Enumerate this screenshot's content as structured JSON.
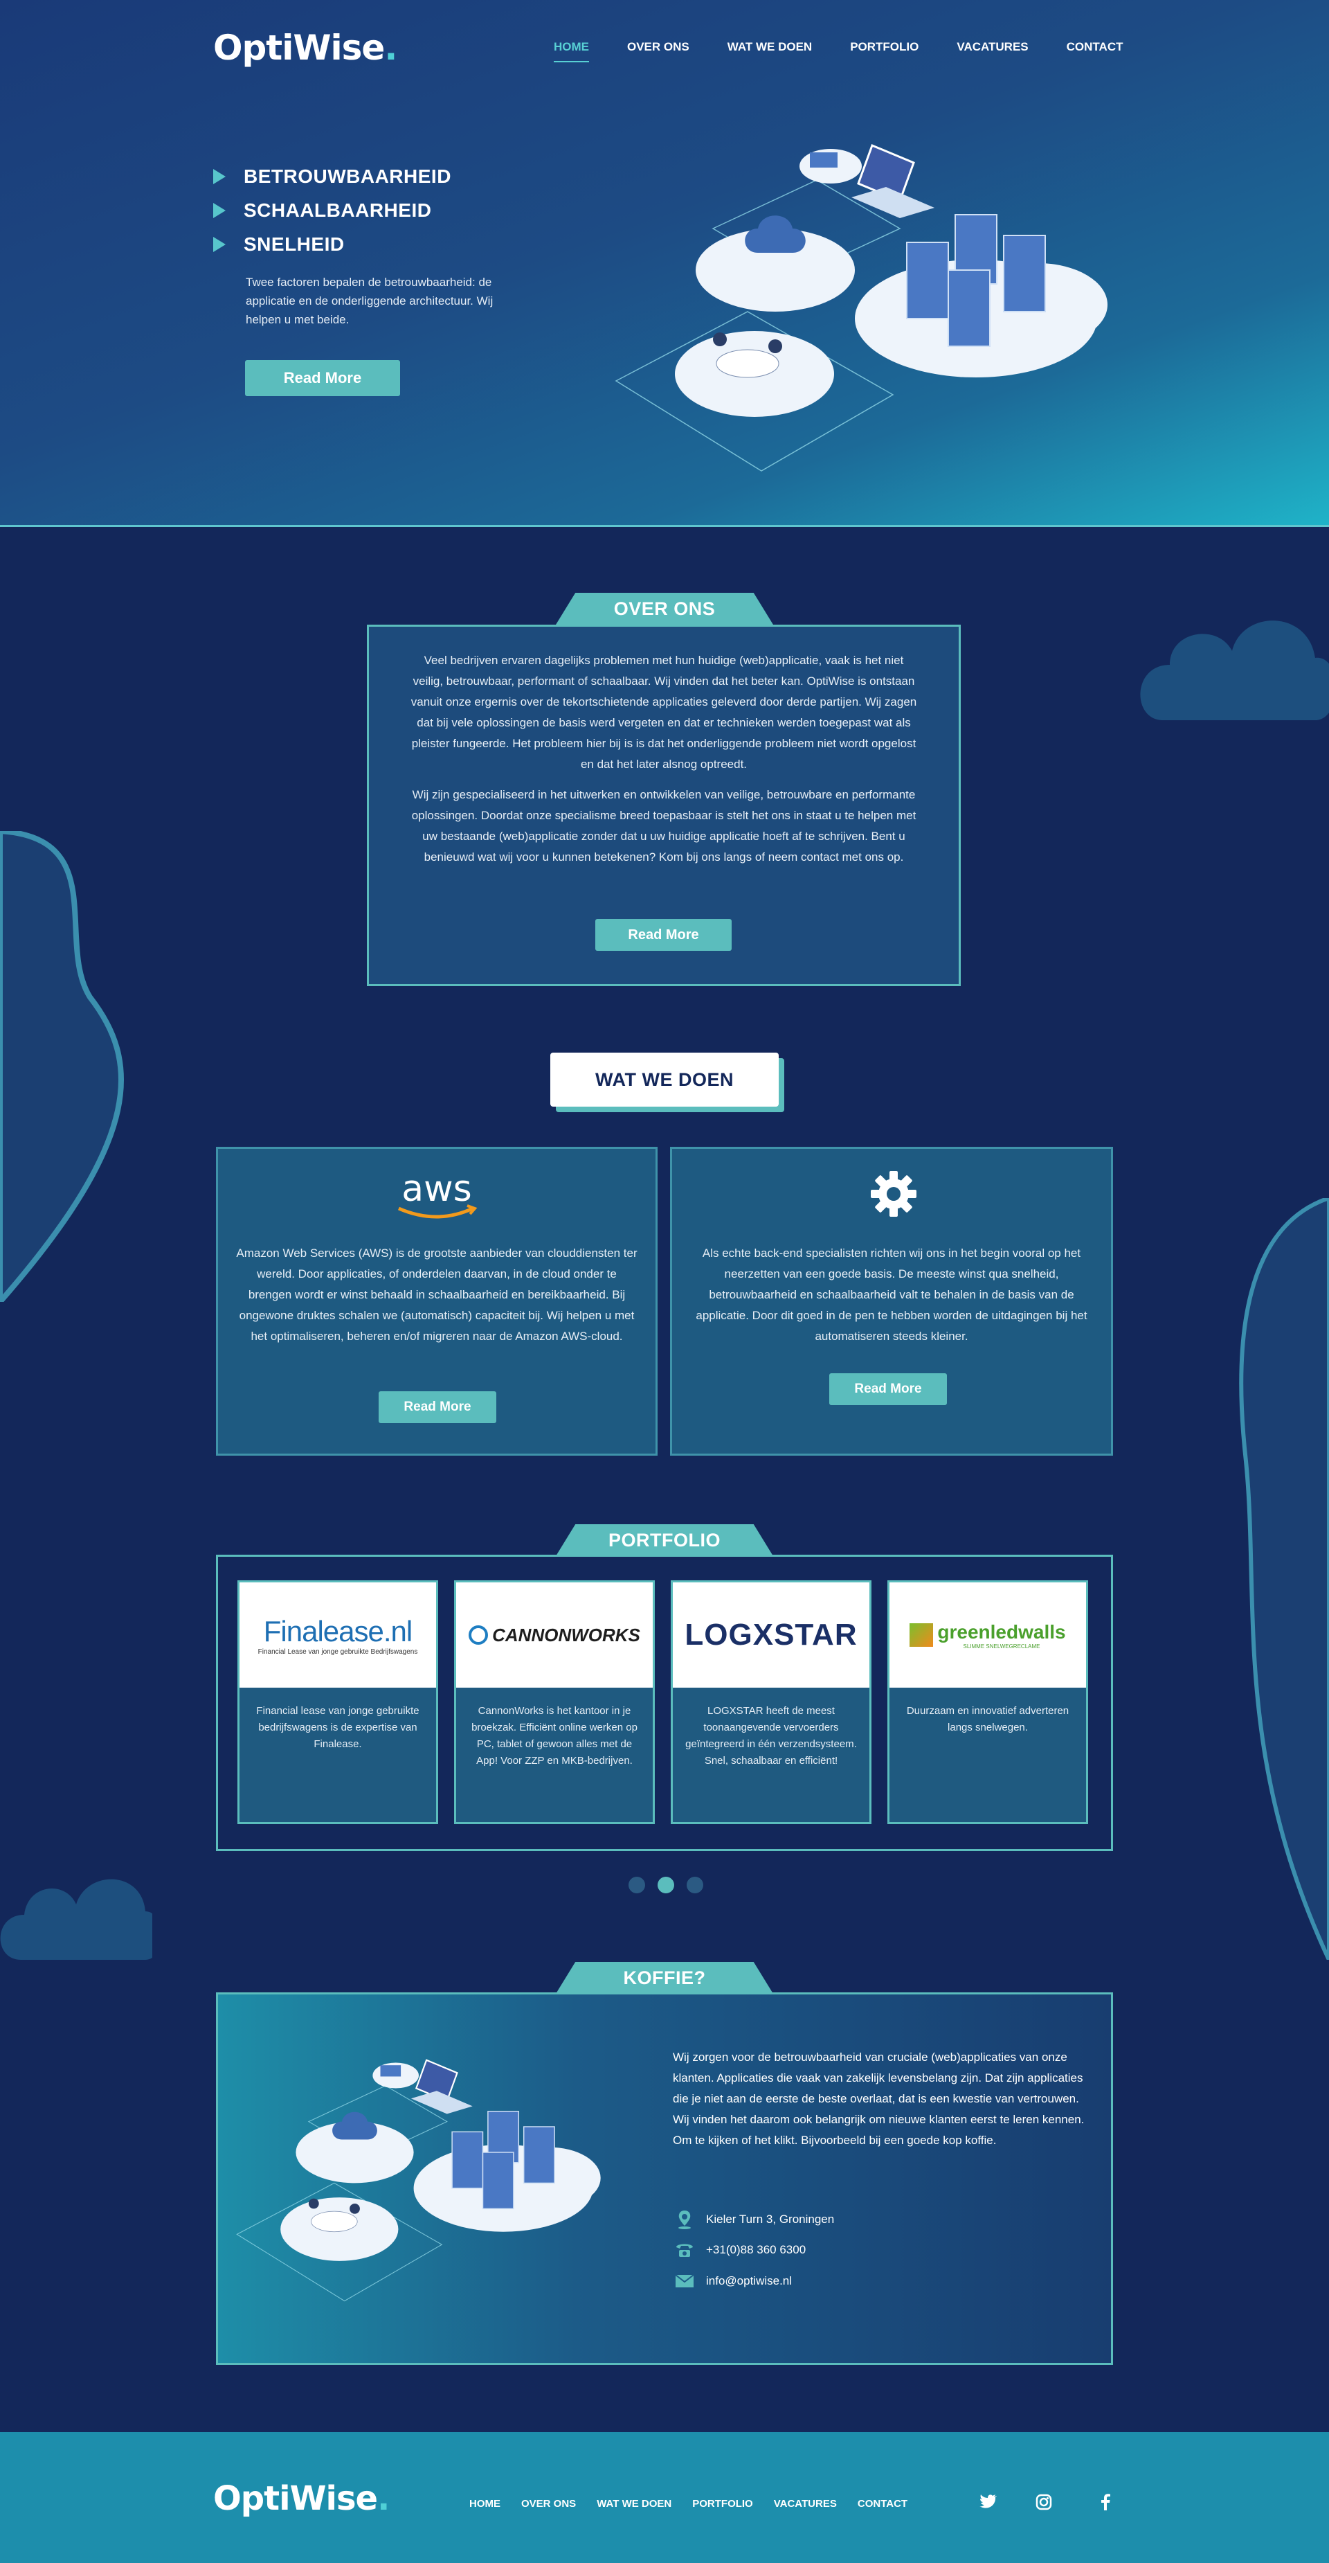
{
  "brand": {
    "name": "OptiWise",
    "dot": "."
  },
  "nav": {
    "items": [
      "HOME",
      "OVER ONS",
      "WAT WE DOEN",
      "PORTFOLIO",
      "VACATURES",
      "CONTACT"
    ],
    "active": "HOME"
  },
  "hero": {
    "bullets": [
      "BETROUWBAARHEID",
      "SCHAALBAARHEID",
      "SNELHEID"
    ],
    "text": "Twee factoren bepalen de betrouwbaarheid: de applicatie en de onderliggende architectuur. Wij helpen u met beide.",
    "button": "Read More"
  },
  "over_ons": {
    "title": "OVER ONS",
    "paragraph1": "Veel bedrijven ervaren dagelijks problemen met hun huidige (web)applicatie, vaak is het niet veilig, betrouwbaar, performant of schaalbaar. Wij vinden dat het beter kan. OptiWise is ontstaan vanuit onze ergernis over de tekortschietende applicaties geleverd door derde partijen. Wij zagen dat bij vele oplossingen de basis werd vergeten en dat er technieken werden toegepast wat als pleister fungeerde. Het probleem hier bij is is dat het onderliggende probleem niet wordt opgelost en dat het later alsnog optreedt.",
    "paragraph2": "Wij zijn gespecialiseerd in het uitwerken en ontwikkelen van veilige, betrouwbare en performante oplossingen. Doordat onze specialisme breed toepasbaar is stelt het ons in staat u te helpen met uw bestaande (web)applicatie zonder dat u uw huidige applicatie hoeft af te schrijven. Bent u benieuwd wat wij voor u kunnen betekenen? Kom bij ons langs of neem contact met ons op.",
    "button": "Read More"
  },
  "wat_we_doen": {
    "title": "WAT WE DOEN",
    "cards": [
      {
        "logo": "aws",
        "icon": "aws-logo-icon",
        "text": "Amazon Web Services (AWS) is de grootste aanbieder van clouddiensten ter wereld. Door applicaties, of onderdelen daarvan, in de cloud onder te brengen wordt er winst behaald in schaalbaarheid en bereikbaarheid. Bij ongewone druktes schalen we (automatisch) capaciteit bij. Wij helpen u met het optimaliseren, beheren en/of migreren naar de Amazon AWS-cloud.",
        "button": "Read More"
      },
      {
        "icon": "gear-icon",
        "text": "Als echte back-end specialisten richten wij ons in het begin vooral op het neerzetten van een goede basis. De meeste winst qua snelheid, betrouwbaarheid en schaalbaarheid valt te behalen in de basis van de applicatie. Door dit goed in de pen te hebben worden de uitdagingen bij het automatiseren steeds kleiner.",
        "button": "Read More"
      }
    ]
  },
  "portfolio": {
    "title": "PORTFOLIO",
    "items": [
      {
        "logo_text": "Finalease.nl",
        "logo_sub": "Financial Lease van jonge gebruikte Bedrijfswagens",
        "text": "Financial lease van jonge gebruikte bedrijfswagens is de expertise van Finalease."
      },
      {
        "logo_text": "CANNONWORKS",
        "text": "CannonWorks is het kantoor in je broekzak. Efficiënt online werken op PC, tablet of gewoon alles met de App! Voor ZZP en MKB-bedrijven."
      },
      {
        "logo_text": "LOGXSTAR",
        "text": "LOGXSTAR heeft de meest toonaangevende vervoerders geïntegreerd in één verzendsysteem. Snel, schaalbaar en efficiënt!"
      },
      {
        "logo_text": "greenledwalls",
        "logo_sub": "SLIMME SNELWEGRECLAME",
        "text": "Duurzaam en innovatief adverteren langs snelwegen."
      }
    ],
    "dots": 3,
    "active_dot": 2
  },
  "koffie": {
    "title": "KOFFIE?",
    "text": "Wij zorgen voor de betrouwbaarheid van cruciale (web)applicaties van onze klanten. Applicaties die vaak van zakelijk levensbelang zijn. Dat zijn applicaties die je niet aan de eerste de beste overlaat, dat is een kwestie van vertrouwen. Wij vinden het daarom ook belangrijk om nieuwe klanten eerst te leren kennen. Om te kijken of het klikt. Bijvoorbeeld bij een goede kop koffie.",
    "address": "Kieler Turn 3, Groningen",
    "phone": "+31(0)88 360 6300",
    "email": "info@optiwise.nl"
  },
  "footer": {
    "nav": [
      "HOME",
      "OVER ONS",
      "WAT WE DOEN",
      "PORTFOLIO",
      "VACATURES",
      "CONTACT"
    ],
    "social": [
      "twitter-icon",
      "instagram-icon",
      "facebook-icon"
    ]
  },
  "colors": {
    "accent": "#5bbdbd",
    "navy": "#13275a",
    "footer": "#1d8eac"
  }
}
